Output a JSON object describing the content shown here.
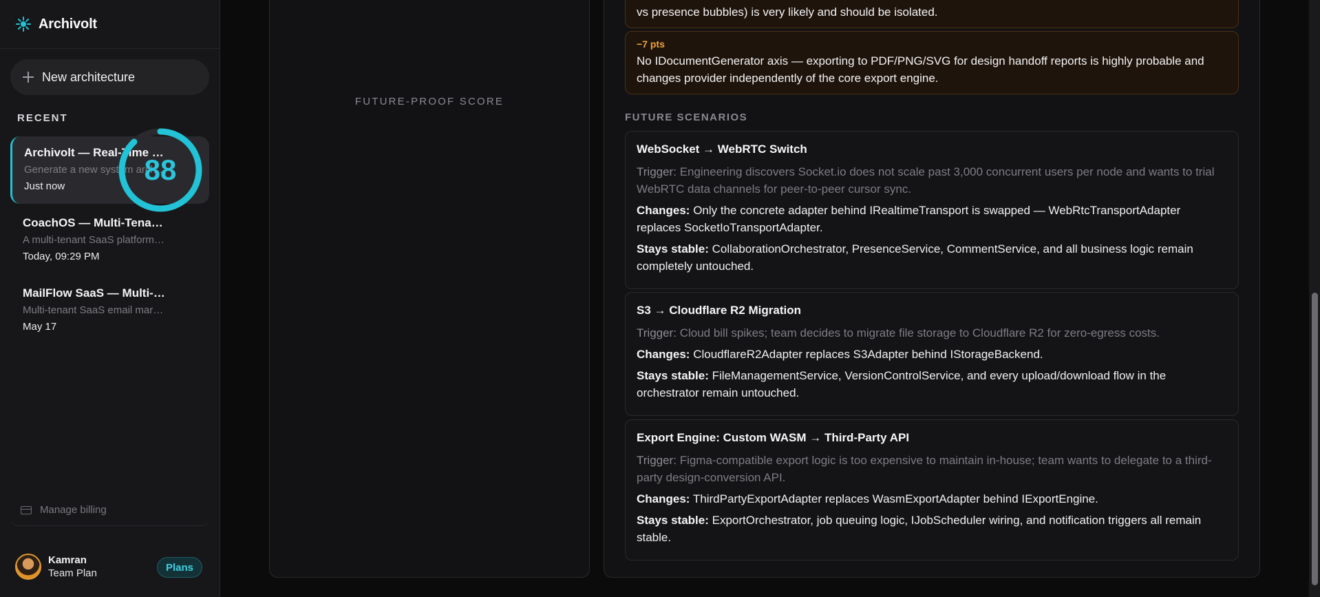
{
  "app": {
    "name": "Archivolt"
  },
  "sidebar": {
    "new_button": "New architecture",
    "recent_heading": "RECENT",
    "items": [
      {
        "title": "Archivolt — Real-Time …",
        "subtitle": "Generate a new system arch…",
        "time": "Just now"
      },
      {
        "title": "CoachOS — Multi-Tena…",
        "subtitle": "A multi-tenant SaaS platform…",
        "time": "Today, 09:29 PM"
      },
      {
        "title": "MailFlow SaaS — Multi-…",
        "subtitle": "Multi-tenant SaaS email mar…",
        "time": "May 17"
      }
    ],
    "billing": "Manage billing",
    "user": {
      "name": "Kamran",
      "plan": "Team Plan"
    },
    "plans_button": "Plans"
  },
  "score": {
    "label": "FUTURE-PROOF SCORE",
    "value": "88",
    "fraction": 0.88,
    "accent": "#22c3d6"
  },
  "warnings": [
    {
      "pts": "",
      "text": "vs presence bubbles) is very likely and should be isolated."
    },
    {
      "pts": "−7 pts",
      "text": "No IDocumentGenerator axis — exporting to PDF/PNG/SVG for design handoff reports is highly probable and changes provider independently of the core export engine."
    }
  ],
  "scenarios_heading": "FUTURE SCENARIOS",
  "labels": {
    "trigger": "Trigger:",
    "changes": "Changes:",
    "stable": "Stays stable:"
  },
  "scenarios": [
    {
      "title": "WebSocket → WebRTC Switch",
      "trigger": "Engineering discovers Socket.io does not scale past 3,000 concurrent users per node and wants to trial WebRTC data channels for peer-to-peer cursor sync.",
      "changes": "Only the concrete adapter behind IRealtimeTransport is swapped — WebRtcTransportAdapter replaces SocketIoTransportAdapter.",
      "stable": "CollaborationOrchestrator, PresenceService, CommentService, and all business logic remain completely untouched."
    },
    {
      "title": "S3 → Cloudflare R2 Migration",
      "trigger": "Cloud bill spikes; team decides to migrate file storage to Cloudflare R2 for zero-egress costs.",
      "changes": "CloudflareR2Adapter replaces S3Adapter behind IStorageBackend.",
      "stable": "FileManagementService, VersionControlService, and every upload/download flow in the orchestrator remain untouched."
    },
    {
      "title": "Export Engine: Custom WASM → Third-Party API",
      "trigger": "Figma-compatible export logic is too expensive to maintain in-house; team wants to delegate to a third-party design-conversion API.",
      "changes": "ThirdPartyExportAdapter replaces WasmExportAdapter behind IExportEngine.",
      "stable": "ExportOrchestrator, job queuing logic, IJobScheduler wiring, and notification triggers all remain stable."
    }
  ]
}
